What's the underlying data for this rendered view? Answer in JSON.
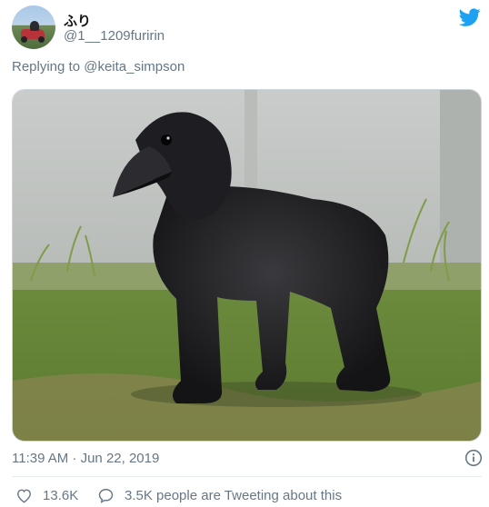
{
  "tweet": {
    "display_name": "ふり",
    "handle": "@1__1209furirin",
    "replying_to": "Replying to @keita_simpson",
    "timestamp": "11:39 AM · Jun 22, 2019",
    "likes": "13.6K",
    "talk": "3.5K people are Tweeting about this"
  },
  "colors": {
    "twitter_blue": "#1da1f2",
    "secondary_text": "#657786"
  },
  "icons": [
    "twitter-logo-icon",
    "info-icon",
    "heart-icon",
    "comment-icon"
  ]
}
